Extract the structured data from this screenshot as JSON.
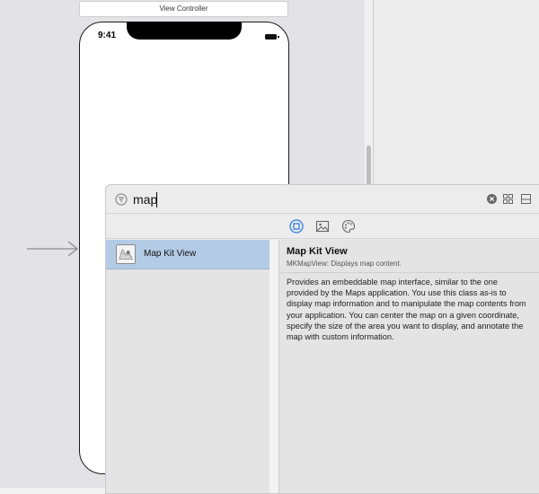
{
  "canvas": {
    "scene_title": "View Controller",
    "status_time": "9:41"
  },
  "library": {
    "search": {
      "value": "map",
      "placeholder": ""
    },
    "tabs": [
      {
        "icon": "square-in-circle-icon",
        "selected": true
      },
      {
        "icon": "photo-icon",
        "selected": false
      },
      {
        "icon": "palette-icon",
        "selected": false
      }
    ],
    "results": [
      {
        "label": "Map Kit View",
        "icon": "map-kit-view-icon",
        "selected": true
      }
    ],
    "detail": {
      "title": "Map Kit View",
      "subtitle": "MKMapView: Displays map content.",
      "description": "Provides an embeddable map interface, similar to the one provided by the Maps application. You use this class as-is to display map information and to manipulate the map contents from your application. You can center the map on a given coordinate, specify the size of the area you want to display, and annotate the map with custom information."
    }
  },
  "colors": {
    "accent": "#2f7de1",
    "selection": "#b4cbe6",
    "canvas_background": "#e3e3e6"
  }
}
